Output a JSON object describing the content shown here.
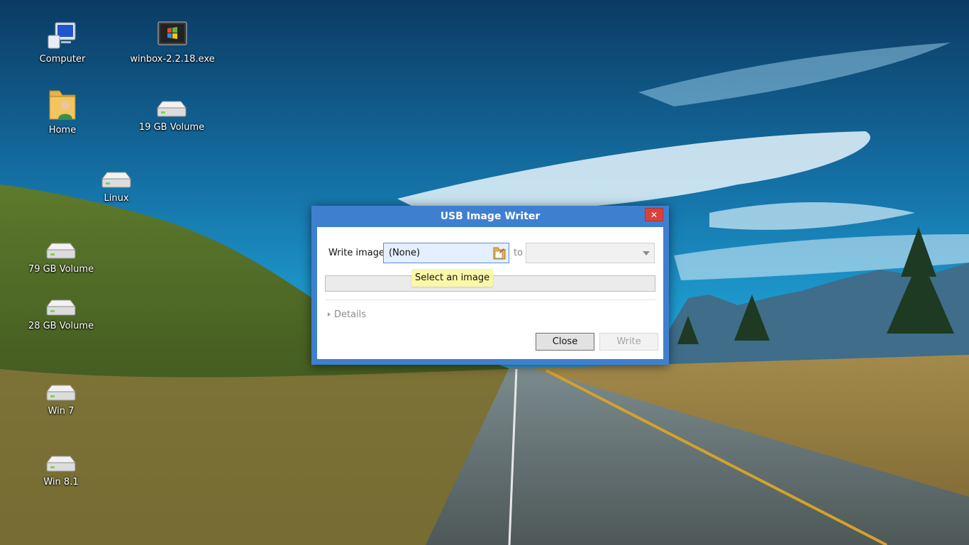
{
  "desktop": {
    "icons": [
      {
        "label": "Computer",
        "icon": "computer-icon"
      },
      {
        "label": "winbox-2.2.18.exe",
        "icon": "winbox-exe-icon"
      },
      {
        "label": "Home",
        "icon": "home-folder-icon"
      },
      {
        "label": "19 GB Volume",
        "icon": "drive-icon"
      },
      {
        "label": "Linux",
        "icon": "drive-icon"
      },
      {
        "label": "79 GB Volume",
        "icon": "drive-icon"
      },
      {
        "label": "28 GB Volume",
        "icon": "drive-icon"
      },
      {
        "label": "Win 7",
        "icon": "drive-icon"
      },
      {
        "label": "Win 8.1",
        "icon": "drive-icon"
      }
    ]
  },
  "dialog": {
    "title": "USB Image Writer",
    "close_glyph": "✕",
    "write_image_label": "Write image:",
    "image_value": "(None)",
    "to_label": "to",
    "device_value": "",
    "tooltip": "Select an image",
    "details_label": "Details",
    "close_button": "Close",
    "write_button": "Write",
    "colors": {
      "titlebar": "#3f7fd0",
      "close_x": "#d9413f",
      "tooltip": "#fbf7a8",
      "field_bg": "#e4efff"
    }
  }
}
